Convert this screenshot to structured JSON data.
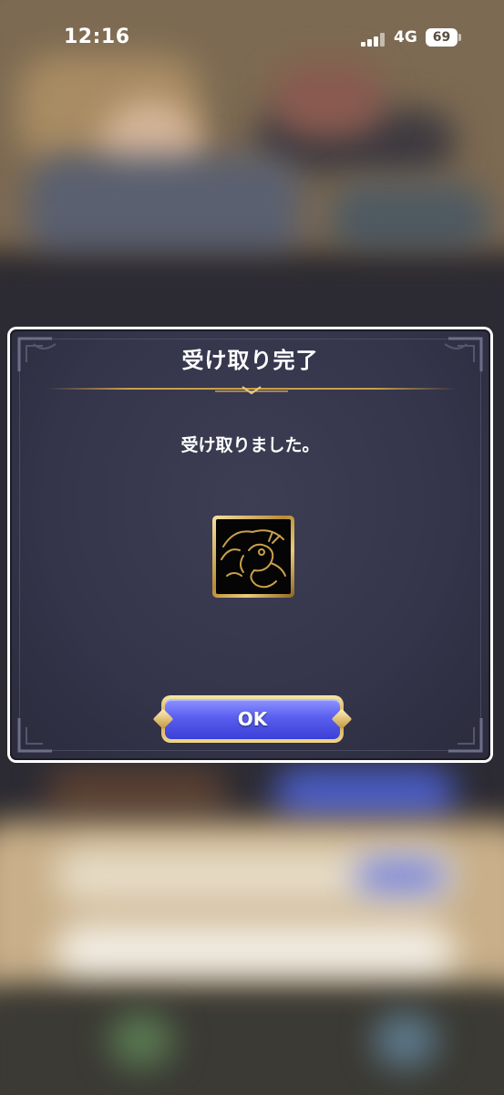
{
  "status_bar": {
    "time": "12:16",
    "network": "4G",
    "battery": "69"
  },
  "dialog": {
    "title": "受け取り完了",
    "message": "受け取りました。",
    "item_icon": "golden-dragon-icon",
    "ok_label": "OK"
  },
  "colors": {
    "dialog_bg": "#34344a",
    "gold_accent": "#c9a04a",
    "ok_button": "#5a5ff0"
  }
}
